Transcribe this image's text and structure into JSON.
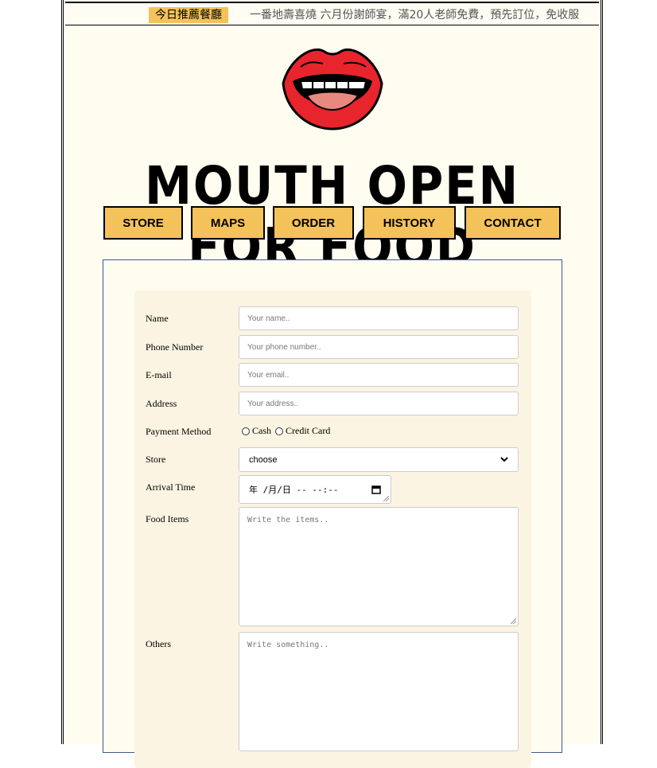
{
  "ticker": {
    "label": "今日推薦餐廳",
    "text": "一番地壽喜燒 六月份謝師宴，滿20人老師免費，預先訂位，免收服"
  },
  "logo": {
    "text": "MOUTH OPEN FOR FOOD",
    "lip_color": "#e8242c"
  },
  "nav": [
    {
      "label": "STORE"
    },
    {
      "label": "MAPS"
    },
    {
      "label": "ORDER"
    },
    {
      "label": "HISTORY"
    },
    {
      "label": "CONTACT"
    }
  ],
  "form": {
    "name_label": "Name",
    "name_placeholder": "Your name..",
    "phone_label": "Phone Number",
    "phone_placeholder": "Your phone number..",
    "email_label": "E-mail",
    "email_placeholder": "Your email..",
    "address_label": "Address",
    "address_placeholder": "Your address..",
    "payment_label": "Payment Method",
    "payment_options": [
      "Cash",
      "Credit Card"
    ],
    "store_label": "Store",
    "store_value": "choose",
    "arrival_label": "Arrival Time",
    "arrival_value": "年 /月/日  -- --:--",
    "food_label": "Food Items",
    "food_placeholder": "Write the items..",
    "others_label": "Others",
    "others_placeholder": "Write something.."
  },
  "colors": {
    "accent": "#f4c25a",
    "page_bg": "#fffcf0",
    "card_bg": "#fbf4e2",
    "form_border": "#3a5a8c"
  }
}
